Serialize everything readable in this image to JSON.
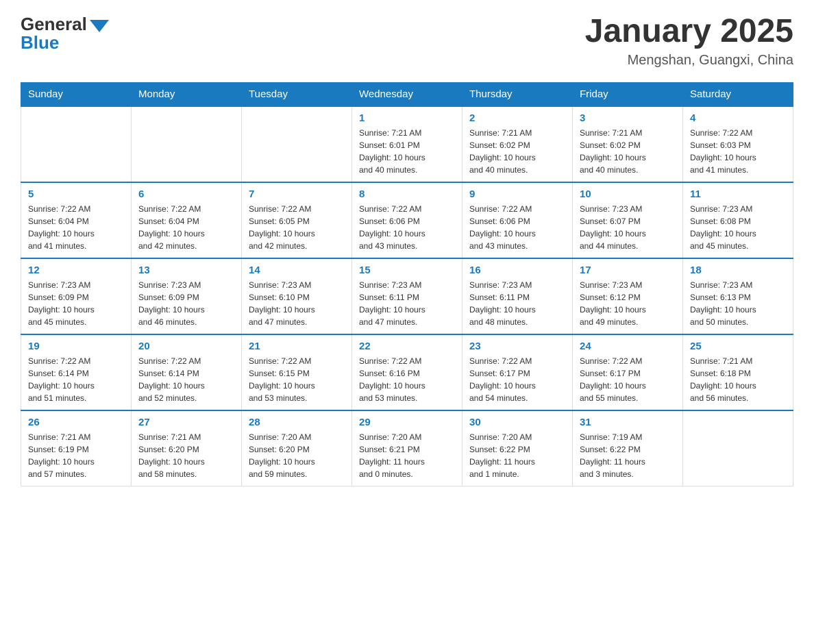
{
  "logo": {
    "general": "General",
    "blue": "Blue"
  },
  "header": {
    "title": "January 2025",
    "subtitle": "Mengshan, Guangxi, China"
  },
  "days_of_week": [
    "Sunday",
    "Monday",
    "Tuesday",
    "Wednesday",
    "Thursday",
    "Friday",
    "Saturday"
  ],
  "weeks": [
    [
      {
        "day": "",
        "info": ""
      },
      {
        "day": "",
        "info": ""
      },
      {
        "day": "",
        "info": ""
      },
      {
        "day": "1",
        "info": "Sunrise: 7:21 AM\nSunset: 6:01 PM\nDaylight: 10 hours\nand 40 minutes."
      },
      {
        "day": "2",
        "info": "Sunrise: 7:21 AM\nSunset: 6:02 PM\nDaylight: 10 hours\nand 40 minutes."
      },
      {
        "day": "3",
        "info": "Sunrise: 7:21 AM\nSunset: 6:02 PM\nDaylight: 10 hours\nand 40 minutes."
      },
      {
        "day": "4",
        "info": "Sunrise: 7:22 AM\nSunset: 6:03 PM\nDaylight: 10 hours\nand 41 minutes."
      }
    ],
    [
      {
        "day": "5",
        "info": "Sunrise: 7:22 AM\nSunset: 6:04 PM\nDaylight: 10 hours\nand 41 minutes."
      },
      {
        "day": "6",
        "info": "Sunrise: 7:22 AM\nSunset: 6:04 PM\nDaylight: 10 hours\nand 42 minutes."
      },
      {
        "day": "7",
        "info": "Sunrise: 7:22 AM\nSunset: 6:05 PM\nDaylight: 10 hours\nand 42 minutes."
      },
      {
        "day": "8",
        "info": "Sunrise: 7:22 AM\nSunset: 6:06 PM\nDaylight: 10 hours\nand 43 minutes."
      },
      {
        "day": "9",
        "info": "Sunrise: 7:22 AM\nSunset: 6:06 PM\nDaylight: 10 hours\nand 43 minutes."
      },
      {
        "day": "10",
        "info": "Sunrise: 7:23 AM\nSunset: 6:07 PM\nDaylight: 10 hours\nand 44 minutes."
      },
      {
        "day": "11",
        "info": "Sunrise: 7:23 AM\nSunset: 6:08 PM\nDaylight: 10 hours\nand 45 minutes."
      }
    ],
    [
      {
        "day": "12",
        "info": "Sunrise: 7:23 AM\nSunset: 6:09 PM\nDaylight: 10 hours\nand 45 minutes."
      },
      {
        "day": "13",
        "info": "Sunrise: 7:23 AM\nSunset: 6:09 PM\nDaylight: 10 hours\nand 46 minutes."
      },
      {
        "day": "14",
        "info": "Sunrise: 7:23 AM\nSunset: 6:10 PM\nDaylight: 10 hours\nand 47 minutes."
      },
      {
        "day": "15",
        "info": "Sunrise: 7:23 AM\nSunset: 6:11 PM\nDaylight: 10 hours\nand 47 minutes."
      },
      {
        "day": "16",
        "info": "Sunrise: 7:23 AM\nSunset: 6:11 PM\nDaylight: 10 hours\nand 48 minutes."
      },
      {
        "day": "17",
        "info": "Sunrise: 7:23 AM\nSunset: 6:12 PM\nDaylight: 10 hours\nand 49 minutes."
      },
      {
        "day": "18",
        "info": "Sunrise: 7:23 AM\nSunset: 6:13 PM\nDaylight: 10 hours\nand 50 minutes."
      }
    ],
    [
      {
        "day": "19",
        "info": "Sunrise: 7:22 AM\nSunset: 6:14 PM\nDaylight: 10 hours\nand 51 minutes."
      },
      {
        "day": "20",
        "info": "Sunrise: 7:22 AM\nSunset: 6:14 PM\nDaylight: 10 hours\nand 52 minutes."
      },
      {
        "day": "21",
        "info": "Sunrise: 7:22 AM\nSunset: 6:15 PM\nDaylight: 10 hours\nand 53 minutes."
      },
      {
        "day": "22",
        "info": "Sunrise: 7:22 AM\nSunset: 6:16 PM\nDaylight: 10 hours\nand 53 minutes."
      },
      {
        "day": "23",
        "info": "Sunrise: 7:22 AM\nSunset: 6:17 PM\nDaylight: 10 hours\nand 54 minutes."
      },
      {
        "day": "24",
        "info": "Sunrise: 7:22 AM\nSunset: 6:17 PM\nDaylight: 10 hours\nand 55 minutes."
      },
      {
        "day": "25",
        "info": "Sunrise: 7:21 AM\nSunset: 6:18 PM\nDaylight: 10 hours\nand 56 minutes."
      }
    ],
    [
      {
        "day": "26",
        "info": "Sunrise: 7:21 AM\nSunset: 6:19 PM\nDaylight: 10 hours\nand 57 minutes."
      },
      {
        "day": "27",
        "info": "Sunrise: 7:21 AM\nSunset: 6:20 PM\nDaylight: 10 hours\nand 58 minutes."
      },
      {
        "day": "28",
        "info": "Sunrise: 7:20 AM\nSunset: 6:20 PM\nDaylight: 10 hours\nand 59 minutes."
      },
      {
        "day": "29",
        "info": "Sunrise: 7:20 AM\nSunset: 6:21 PM\nDaylight: 11 hours\nand 0 minutes."
      },
      {
        "day": "30",
        "info": "Sunrise: 7:20 AM\nSunset: 6:22 PM\nDaylight: 11 hours\nand 1 minute."
      },
      {
        "day": "31",
        "info": "Sunrise: 7:19 AM\nSunset: 6:22 PM\nDaylight: 11 hours\nand 3 minutes."
      },
      {
        "day": "",
        "info": ""
      }
    ]
  ]
}
